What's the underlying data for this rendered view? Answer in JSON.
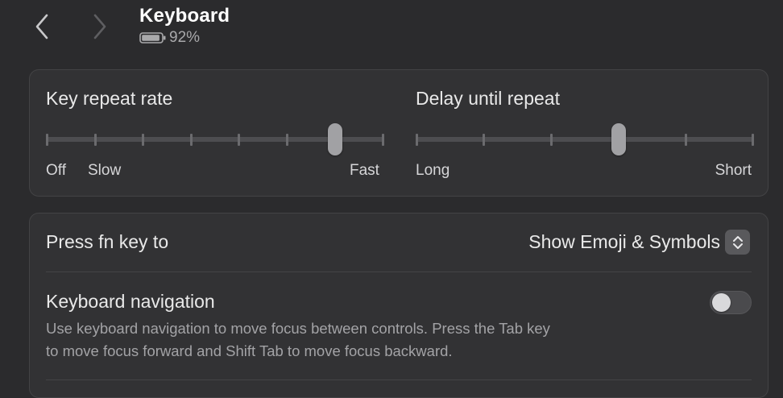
{
  "header": {
    "title": "Keyboard",
    "battery_text": "92%",
    "battery_level": 0.92,
    "back_icon": "chevron-left-icon",
    "forward_icon": "chevron-right-icon"
  },
  "repeat": {
    "key_repeat": {
      "label": "Key repeat rate",
      "caption_off": "Off",
      "caption_slow": "Slow",
      "caption_fast": "Fast",
      "tick_count": 8,
      "selected_index": 6
    },
    "delay": {
      "label": "Delay until repeat",
      "caption_long": "Long",
      "caption_short": "Short",
      "tick_count": 6,
      "selected_index": 3
    }
  },
  "fn_row": {
    "label": "Press fn key to",
    "value": "Show Emoji & Symbols"
  },
  "nav_row": {
    "label": "Keyboard navigation",
    "description_line1": "Use keyboard navigation to move focus between controls. Press the Tab key",
    "description_line2": "to move focus forward and Shift Tab to move focus backward.",
    "enabled": false
  },
  "colors": {
    "background": "#2b2b2d",
    "card": "#323234",
    "thumb": "#a1a1a4"
  }
}
